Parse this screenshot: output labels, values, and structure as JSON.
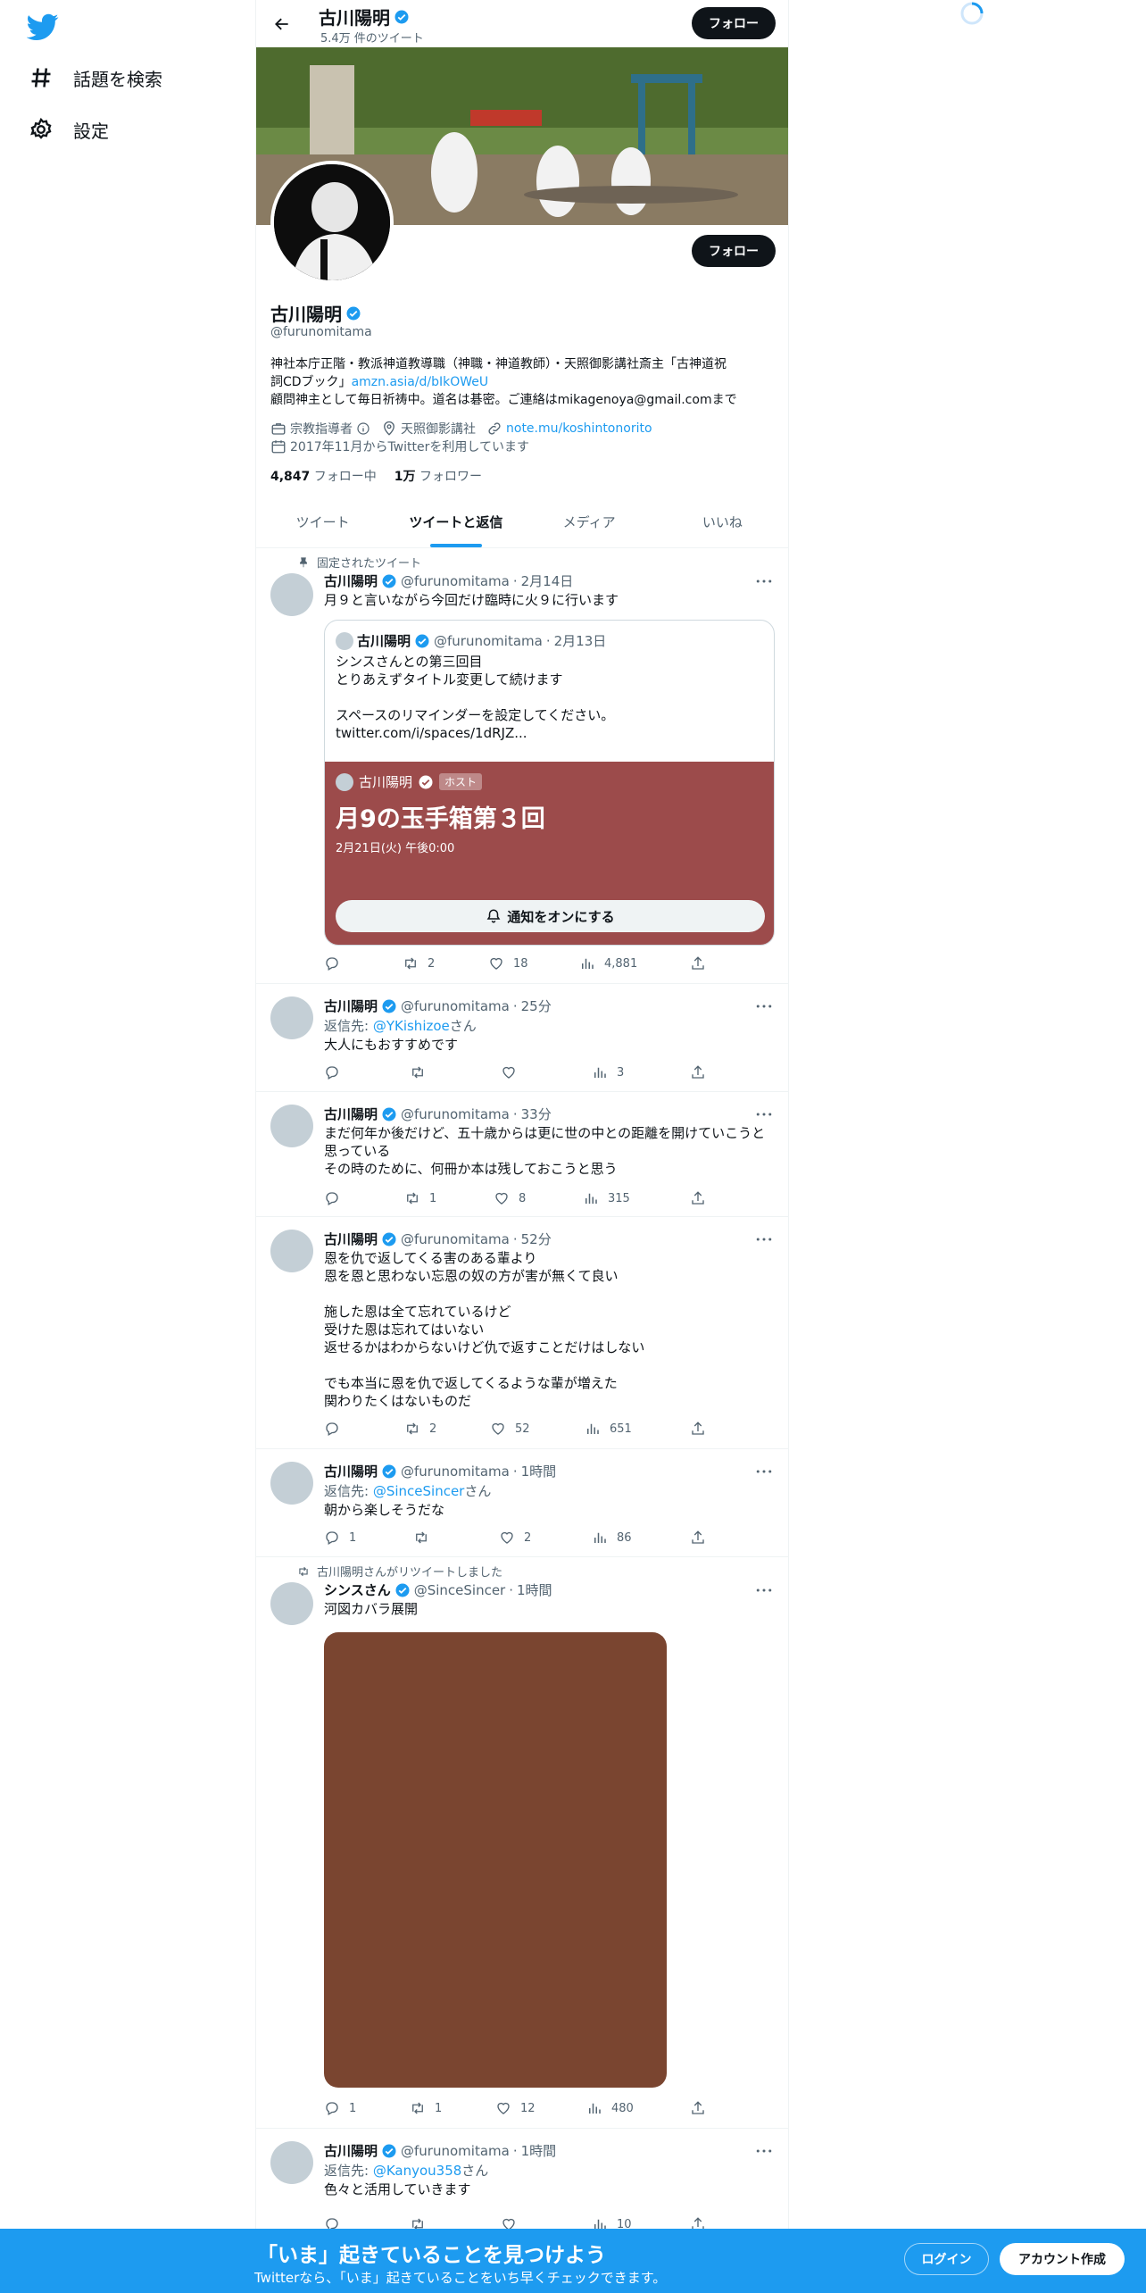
{
  "sidebar": {
    "items": [
      {
        "label": "話題を検索",
        "icon": "hashtag-icon"
      },
      {
        "label": "設定",
        "icon": "gear-icon"
      }
    ]
  },
  "header": {
    "name": "古川陽明",
    "tweet_count": "5.4万 件のツイート",
    "follow_label": "フォロー"
  },
  "profile": {
    "name": "古川陽明",
    "handle": "@furunomitama",
    "follow_label": "フォロー",
    "bio_line1": "神社本庁正階・教派神道教導職（神職・神道教師）・天照御影講社斎主「古神道祝",
    "bio_line2_text": "詞CDブック」",
    "bio_link": "amzn.asia/d/bIkOWeU",
    "bio_line3": "顧問神主として毎日祈祷中。道名は碁密。ご連絡はmikagenoya@gmail.comまで",
    "category": "宗教指導者",
    "location": "天照御影講社",
    "website": "note.mu/koshintonorito",
    "joined": "2017年11月からTwitterを利用しています",
    "following_count": "4,847",
    "following_label": "フォロー中",
    "followers_count": "1万",
    "followers_label": "フォロワー"
  },
  "tabs": [
    "ツイート",
    "ツイートと返信",
    "メディア",
    "いいね"
  ],
  "tweets": {
    "pinned": {
      "context": "固定されたツイート",
      "name": "古川陽明",
      "handle": "@furunomitama",
      "time": "2月14日",
      "text": "月９と言いながら今回だけ臨時に火９に行います",
      "quote": {
        "name": "古川陽明",
        "handle": "@furunomitama",
        "time": "2月13日",
        "text": "シンスさんとの第三回目\nとりあえずタイトル変更して続けます\n\nスペースのリマインダーを設定してください。\ntwitter.com/i/spaces/1dRJZ...",
        "space_host": "古川陽明",
        "space_badge": "ホスト",
        "space_title": "月9の玉手箱第３回",
        "space_date": "2月21日(火) 午後0:00",
        "space_button": "通知をオンにする"
      },
      "retweets": "2",
      "likes": "18",
      "views": "4,881"
    },
    "t2": {
      "name": "古川陽明",
      "handle": "@furunomitama",
      "time": "25分",
      "reply_prefix": "返信先: ",
      "reply_to": "@YKishizoe",
      "reply_suffix": "さん",
      "text": "大人にもおすすめです",
      "views": "3"
    },
    "t3": {
      "name": "古川陽明",
      "handle": "@furunomitama",
      "time": "33分",
      "text": "まだ何年か後だけど、五十歳からは更に世の中との距離を開けていこうと\n思っている\nその時のために、何冊か本は残しておこうと思う",
      "retweets": "1",
      "likes": "8",
      "views": "315"
    },
    "t4": {
      "name": "古川陽明",
      "handle": "@furunomitama",
      "time": "52分",
      "text": "恩を仇で返してくる害のある輩より\n恩を恩と思わない忘恩の奴の方が害が無くて良い\n\n施した恩は全て忘れているけど\n受けた恩は忘れてはいない\n返せるかはわからないけど仇で返すことだけはしない\n\nでも本当に恩を仇で返してくるような輩が増えた\n関わりたくはないものだ",
      "retweets": "2",
      "likes": "52",
      "views": "651"
    },
    "t5": {
      "name": "古川陽明",
      "handle": "@furunomitama",
      "time": "1時間",
      "reply_prefix": "返信先: ",
      "reply_to": "@SinceSincer",
      "reply_suffix": "さん",
      "text": "朝から楽しそうだな",
      "replies": "1",
      "likes": "2",
      "views": "86"
    },
    "t6": {
      "context": "古川陽明さんがリツイートしました",
      "name": "シンスさん",
      "handle": "@SinceSincer",
      "time": "1時間",
      "text": "河図カバラ展開",
      "replies": "1",
      "retweets": "1",
      "likes": "12",
      "views": "480"
    },
    "t7": {
      "name": "古川陽明",
      "handle": "@furunomitama",
      "time": "1時間",
      "reply_prefix": "返信先: ",
      "reply_to": "@Kanyou358",
      "reply_suffix": "さん",
      "text": "色々と活用していきます",
      "views": "10"
    }
  },
  "bottom_bar": {
    "title": "「いま」起きていることを見つけよう",
    "subtitle": "Twitterなら、「いま」起きていることをいち早くチェックできます。",
    "login": "ログイン",
    "signup": "アカウント作成"
  },
  "colors": {
    "accent": "#1d9bf0",
    "space_card": "#9c4b4b",
    "media": "#7a4530"
  }
}
